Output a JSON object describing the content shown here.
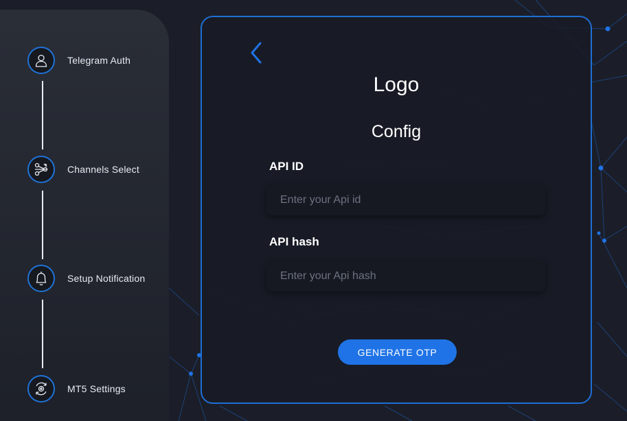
{
  "sidebar": {
    "steps": [
      {
        "label": "Telegram Auth",
        "icon": "user-icon"
      },
      {
        "label": "Channels Select",
        "icon": "channels-icon"
      },
      {
        "label": "Setup Notification",
        "icon": "bell-icon"
      },
      {
        "label": "MT5 Settings",
        "icon": "settings-icon"
      }
    ]
  },
  "card": {
    "back_icon": "chevron-left-icon",
    "logo": "Logo",
    "title": "Config",
    "api_id": {
      "label": "API ID",
      "placeholder": "Enter your Api id",
      "value": ""
    },
    "api_hash": {
      "label": "API hash",
      "placeholder": "Enter your Api hash",
      "value": ""
    },
    "generate_button": "GENERATE OTP"
  },
  "colors": {
    "accent": "#1f73e6",
    "background": "#1b1e28",
    "card_border": "#1f6fd6",
    "sidebar": "#2a2e37",
    "text": "#ffffff"
  }
}
